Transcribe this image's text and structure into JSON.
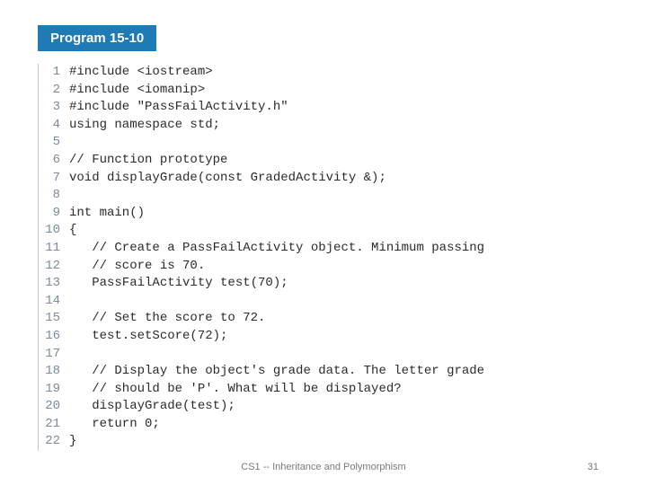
{
  "heading": "Program 15-10",
  "code_lines": [
    {
      "num": "1",
      "text": "#include <iostream>"
    },
    {
      "num": "2",
      "text": "#include <iomanip>"
    },
    {
      "num": "3",
      "text": "#include \"PassFailActivity.h\""
    },
    {
      "num": "4",
      "text": "using namespace std;"
    },
    {
      "num": "5",
      "text": ""
    },
    {
      "num": "6",
      "text": "// Function prototype"
    },
    {
      "num": "7",
      "text": "void displayGrade(const GradedActivity &);"
    },
    {
      "num": "8",
      "text": ""
    },
    {
      "num": "9",
      "text": "int main()"
    },
    {
      "num": "10",
      "text": "{"
    },
    {
      "num": "11",
      "text": "   // Create a PassFailActivity object. Minimum passing"
    },
    {
      "num": "12",
      "text": "   // score is 70."
    },
    {
      "num": "13",
      "text": "   PassFailActivity test(70);"
    },
    {
      "num": "14",
      "text": ""
    },
    {
      "num": "15",
      "text": "   // Set the score to 72."
    },
    {
      "num": "16",
      "text": "   test.setScore(72);"
    },
    {
      "num": "17",
      "text": ""
    },
    {
      "num": "18",
      "text": "   // Display the object's grade data. The letter grade"
    },
    {
      "num": "19",
      "text": "   // should be 'P'. What will be displayed?"
    },
    {
      "num": "20",
      "text": "   displayGrade(test);"
    },
    {
      "num": "21",
      "text": "   return 0;"
    },
    {
      "num": "22",
      "text": "}"
    }
  ],
  "footer": "CS1 -- Inheritance and Polymorphism",
  "page_number": "31"
}
